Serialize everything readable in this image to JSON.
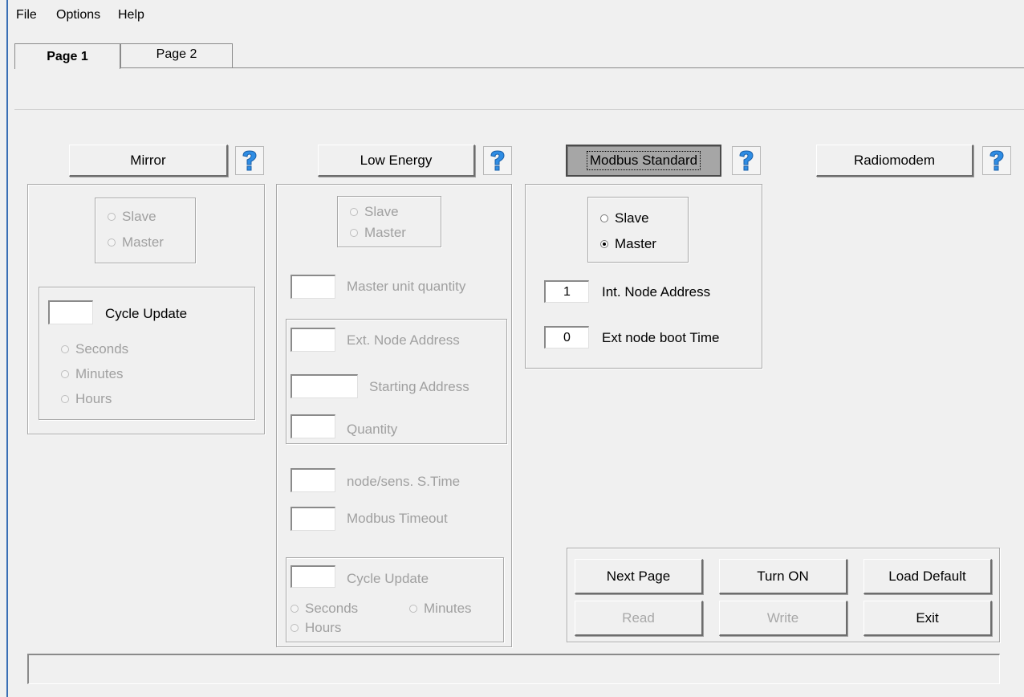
{
  "menu": {
    "file": "File",
    "options": "Options",
    "help": "Help"
  },
  "tabs": [
    {
      "label": "Page 1",
      "active": true
    },
    {
      "label": "Page 2",
      "active": false
    }
  ],
  "icons": {
    "help": "help-question-icon"
  },
  "mirror": {
    "button": "Mirror",
    "slave": "Slave",
    "master": "Master",
    "cycle_value": "",
    "cycle_label": "Cycle Update",
    "seconds": "Seconds",
    "minutes": "Minutes",
    "hours": "Hours"
  },
  "low_energy": {
    "button": "Low Energy",
    "slave": "Slave",
    "master": "Master",
    "master_qty_value": "",
    "master_qty_label": "Master unit quantity",
    "ext_node_value": "",
    "ext_node_label": "Ext. Node Address",
    "start_addr_value": "",
    "start_addr_label": "Starting Address",
    "quantity_value": "",
    "quantity_label": "Quantity",
    "node_sens_value": "",
    "node_sens_label": "node/sens. S.Time",
    "timeout_value": "",
    "timeout_label": "Modbus Timeout",
    "cycle_value": "",
    "cycle_label": "Cycle Update",
    "seconds": "Seconds",
    "minutes": "Minutes",
    "hours": "Hours"
  },
  "modbus": {
    "button": "Modbus Standard",
    "slave": "Slave",
    "master": "Master",
    "selected": "Master",
    "int_node_value": "1",
    "int_node_label": "Int. Node Address",
    "boot_value": "0",
    "boot_label": "Ext node boot Time"
  },
  "radiomodem": {
    "button": "Radiomodem"
  },
  "actions": {
    "next_page": "Next Page",
    "turn_on": "Turn ON",
    "load_default": "Load Default",
    "read": "Read",
    "write": "Write",
    "exit": "Exit"
  },
  "status_text": "",
  "colors": {
    "accent": "#3b6fb5",
    "pressed_bg": "#a6a6a6",
    "disabled_text": "#a0a0a0"
  }
}
